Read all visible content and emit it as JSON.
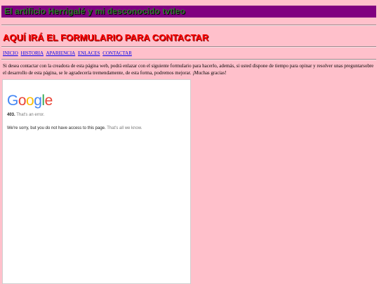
{
  "page": {
    "banner_title": "El artificio Herrigalé y mi desconocido tvtleo",
    "heading": "AQUÍ IRÁ EL FORMULARIO PARA CONTACTAR",
    "nav": [
      "INICIO",
      "HISTORIA",
      "APARIENCIA",
      "ENLACES",
      "CONTACTAR"
    ],
    "paragraph": "Si desea contactar con la creadora de esta página web, podrá enlazar con el siguiente formulario para hacerlo, además, si usted dispone de tiempo para opinar y resolver unas preguntarsobre el desarrollo de esta página, se le agradecería tremendamente, de esta forma, podremos mejorar. ¡Muchas gracias!"
  },
  "embed": {
    "logo": [
      "G",
      "o",
      "o",
      "g",
      "l",
      "e"
    ],
    "error_code": "403.",
    "error_label": "That's an error.",
    "message": "We're sorry, but you do not have access to this page.",
    "message_suffix": "That's all we know."
  },
  "colors": {
    "background": "#ffc0cb",
    "banner": "#800080",
    "heading": "#ff0000",
    "link": "#0000ee"
  }
}
